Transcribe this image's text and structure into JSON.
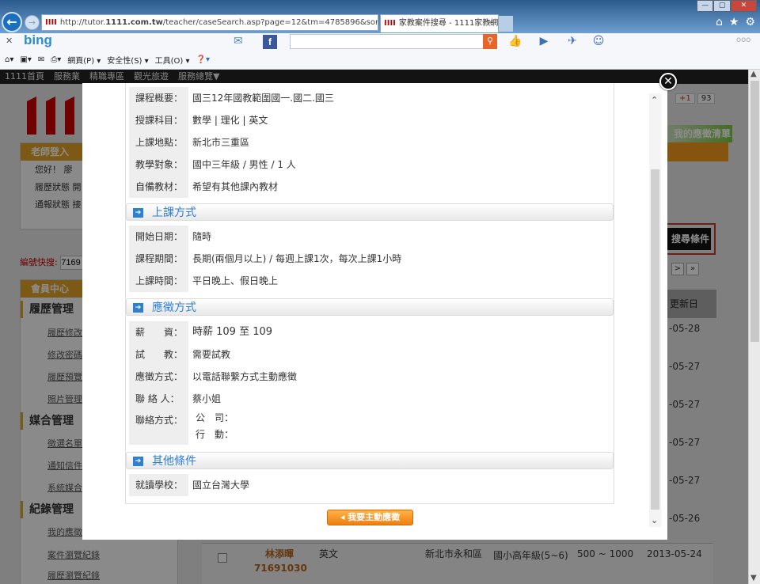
{
  "browser": {
    "url_host_prefix": "http://tutor.",
    "url_host_bold": "1111.com.tw",
    "url_path": "/teacher/caseSearch.asp?page=12&tm=4785896&sortSe",
    "tab_title": "家教案件搜尋 - 1111家教網",
    "favicon": "IIII",
    "bing": "bing",
    "more": "ooo",
    "cmd": [
      "網頁(P) ▾",
      "安全性(S) ▾",
      "工具(O) ▾"
    ]
  },
  "site": {
    "nav": [
      "1111首頁",
      "服務業",
      "精職專區",
      "觀光旅遊",
      "服務總覽▼"
    ],
    "logo": "1111",
    "login": {
      "title": "老師登入",
      "hello": "您好！ 廖",
      "resume": "履歷狀態 開",
      "notify": "通報狀態 接"
    },
    "quick_label": "編號快搜:",
    "quick_value": "7169",
    "member": {
      "title": "會員中心",
      "groups": [
        {
          "name": "履歷管理",
          "links": [
            "履歷修改",
            "修改密碼",
            "履歷預覽",
            "照片管理"
          ]
        },
        {
          "name": "媒合管理",
          "links": [
            "徵選名單",
            "通知信件",
            "系統媒合"
          ]
        },
        {
          "name": "紀錄管理",
          "links": [
            "我的應徵",
            "案件瀏覽紀錄",
            "履歷瀏覽紀錄"
          ]
        }
      ]
    },
    "gplus": "+1",
    "gplus_count": "93",
    "green_label": "我的應徵清單",
    "search_btn": "搜尋條件",
    "pager": [
      ">",
      "»"
    ],
    "table": {
      "update_header": "更新日",
      "dates": [
        "-05-28",
        "-05-27",
        "-05-27",
        "-05-27",
        "-05-27",
        "-05-26"
      ],
      "last_row": {
        "name": "林添暉",
        "id": "71691030",
        "subject": "英文",
        "area": "新北市永和區",
        "grade": "國小高年級(5~6)",
        "pay": "500 ~ 1000",
        "date": "2013-05-24"
      }
    }
  },
  "modal": {
    "rows1": [
      {
        "label": "課程概要：",
        "value": "國三12年國教範圍國一.國二.國三"
      },
      {
        "label": "授課科目：",
        "value": "數學 | 理化 | 英文"
      },
      {
        "label": "上課地點：",
        "value": "新北市三重區"
      },
      {
        "label": "教學對象：",
        "value": "國中三年級 / 男性 / 1 人"
      },
      {
        "label": "自備教材：",
        "value": "希望有其他課內教材"
      }
    ],
    "sections": [
      "上課方式",
      "應徵方式",
      "其他條件"
    ],
    "rows2": [
      {
        "label": "開始日期：",
        "value": "隨時"
      },
      {
        "label": "課程期間：",
        "value": "長期(兩個月以上) / 每週上課1次，每次上課1小時"
      },
      {
        "label": "上課時間：",
        "value": "平日晚上、假日晚上"
      }
    ],
    "rows3": [
      {
        "label": "薪　　資：",
        "value": "時薪 109 至 109"
      },
      {
        "label": "試　　教：",
        "value": "需要試教"
      },
      {
        "label": "應徵方式：",
        "value": "以電話聯繫方式主動應徵"
      },
      {
        "label": "聯 絡 人：",
        "value": "蔡小姐"
      }
    ],
    "contact": {
      "label": "聯絡方式：",
      "company": "公　司：",
      "mobile": "行　動："
    },
    "rows4": [
      {
        "label": "就讀學校：",
        "value": "國立台灣大學"
      }
    ],
    "apply_button": "我要主動應徵"
  }
}
